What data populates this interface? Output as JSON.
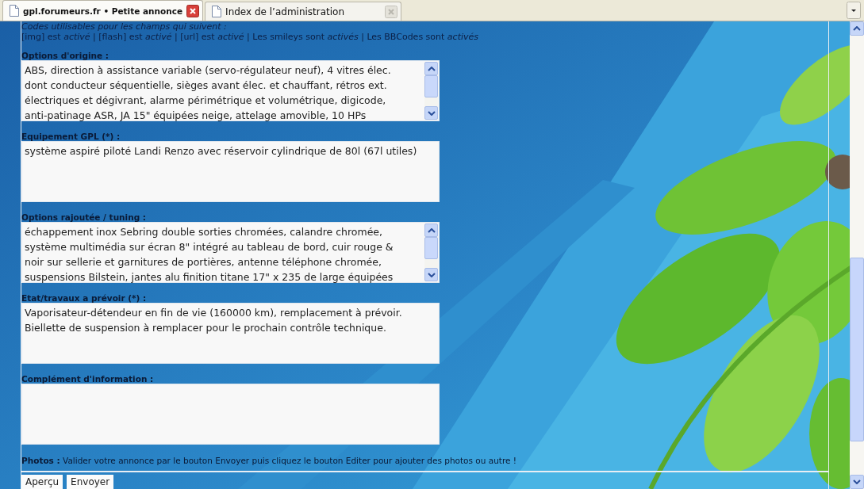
{
  "tabs": [
    {
      "label": "gpl.forumeurs.fr • Petite annonce",
      "selected": true
    },
    {
      "label": "Index de l’administration",
      "selected": false
    }
  ],
  "codes": {
    "title": "Codes utilisables pour les champs qui suivent :",
    "status": "[img] est *activé* | [flash] est *activé* | [url] est *activé* | Les smileys sont *activés* | Les BBCodes sont *activés*"
  },
  "fields": [
    {
      "label": "Options d'origine :",
      "scrollbar": true,
      "lines": [
        "ABS, direction à assistance variable (servo-régulateur neuf), 4 vitres élec.",
        "dont conducteur séquentielle, sièges avant élec. et chauffant, rétros ext.",
        "électriques et dégivrant, alarme périmétrique et volumétrique, digicode,",
        "anti-patinage ASR, JA 15\" équipées neige, attelage amovible, 10 HPs"
      ]
    },
    {
      "label": "Equipement GPL (*) :",
      "scrollbar": false,
      "lines": [
        "système aspiré piloté Landi Renzo avec réservoir cylindrique de 80l (67l utiles)"
      ]
    },
    {
      "label": "Options rajoutée / tuning :",
      "scrollbar": true,
      "lines": [
        "échappement inox Sebring double sorties chromées, calandre chromée,",
        "système multimédia sur écran 8\" intégré au tableau de bord, cuir rouge &",
        "noir sur sellerie et garnitures de portières, antenne téléphone chromée,",
        "suspensions Bilstein, jantes alu finition titane 17\" x 235 de large équipées"
      ]
    },
    {
      "label": "Etat/travaux a prévoir (*) :",
      "scrollbar": false,
      "lines": [
        "Vaporisateur-détendeur en fin de vie (160000 km), remplacement à prévoir.",
        "Biellette de suspension à remplacer pour le prochain contrôle technique."
      ]
    },
    {
      "label": "Complément d'information :",
      "scrollbar": false
    }
  ],
  "photos_note": "**Photos :** Valider votre annonce par le bouton Envoyer puis cliquez le bouton Editer pour ajouter des photos ou autre !",
  "buttons": [
    "Aperçu",
    "Envoyer"
  ]
}
